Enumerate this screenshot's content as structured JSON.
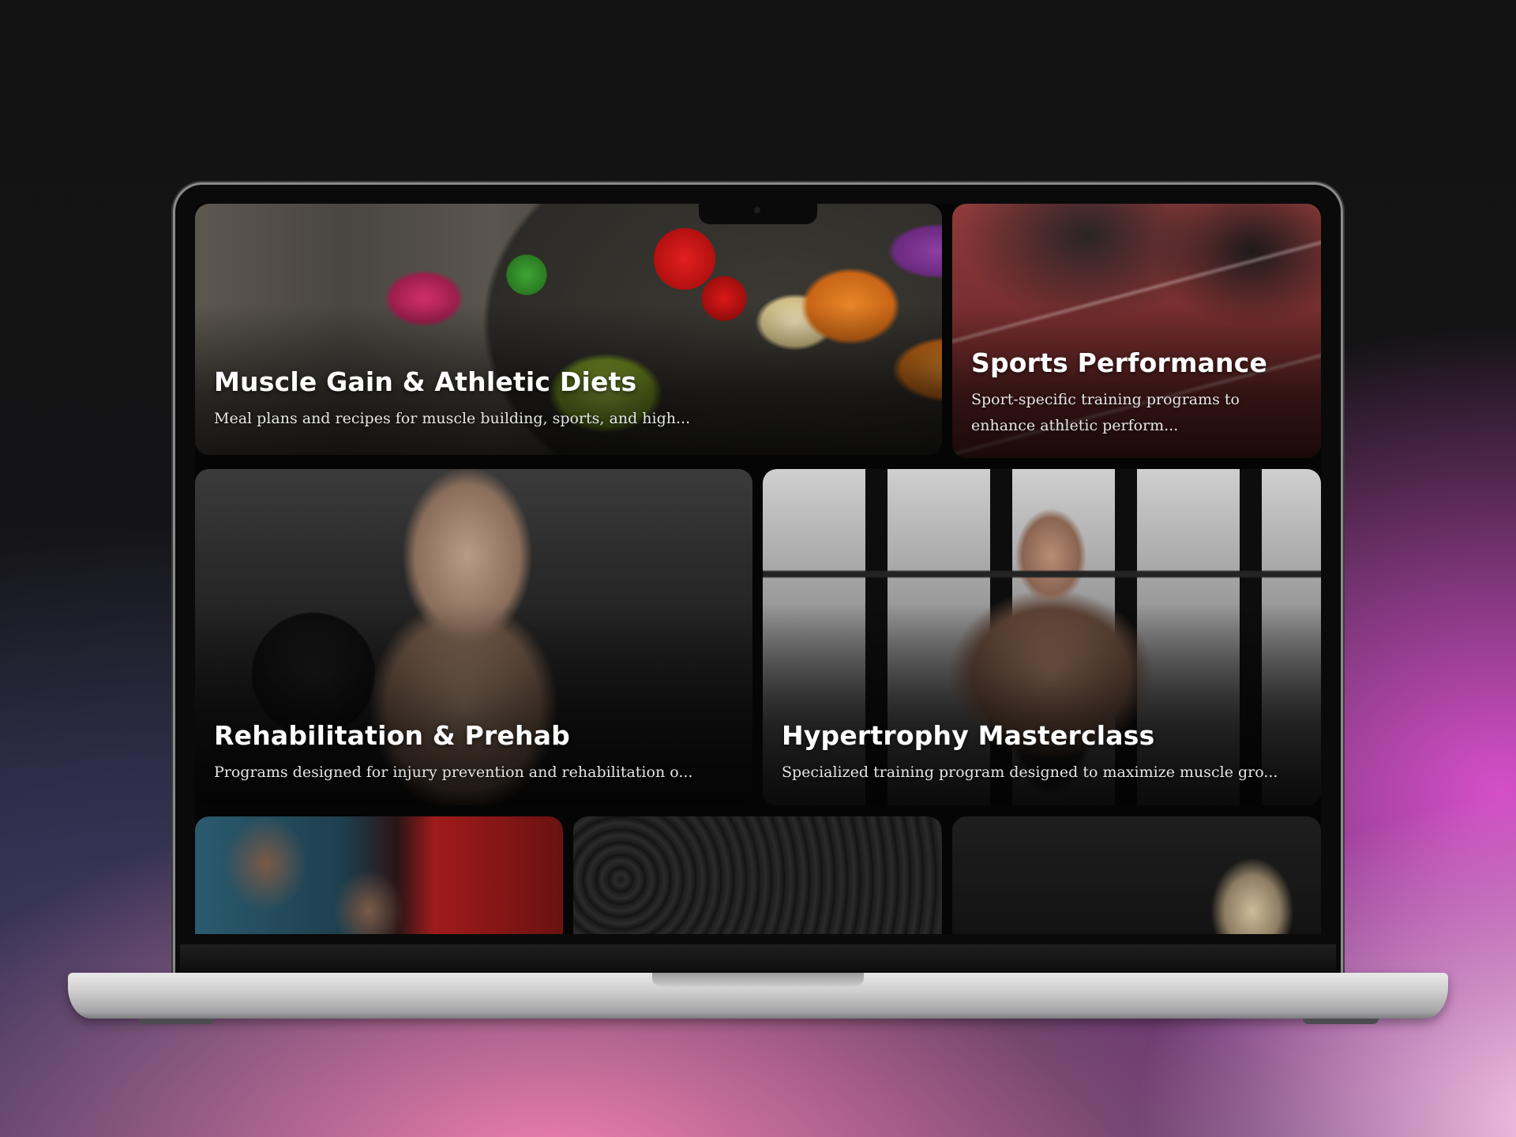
{
  "cards": [
    {
      "title": "Muscle Gain & Athletic Diets",
      "description": "Meal plans and recipes for muscle building, sports, and high..."
    },
    {
      "title": "Sports Performance",
      "description": "Sport-specific training programs to enhance athletic perform..."
    },
    {
      "title": "Rehabilitation & Prehab",
      "description": "Programs designed for injury prevention and rehabilitation o..."
    },
    {
      "title": "Hypertrophy Masterclass",
      "description": "Specialized training program designed to maximize muscle gro..."
    }
  ],
  "colors": {
    "background_top": "#131313",
    "background_accent_magenta": "#d54fc8",
    "background_accent_pink": "#ef7fae",
    "laptop_silver": "#cfcfd0",
    "card_title": "#ffffff",
    "card_description": "#e6e6e6"
  }
}
